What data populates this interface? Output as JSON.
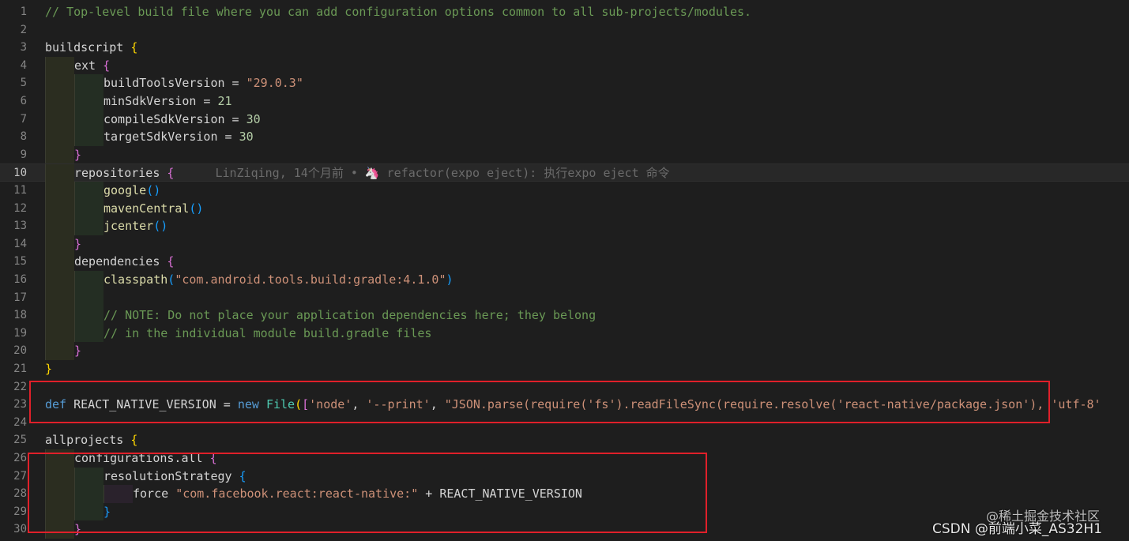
{
  "blame": {
    "text": "LinZiqing, 14个月前 • 🦄 refactor(expo eject): 执行expo eject 命令"
  },
  "watermarks": {
    "primary": "CSDN @前端小菜_AS32H1",
    "secondary": "@稀土掘金技术社区"
  },
  "lines": [
    {
      "n": "1",
      "indent": 0,
      "tokens": [
        [
          "// Top-level build file where you can add configuration options common to all sub-projects/modules.",
          "com"
        ]
      ]
    },
    {
      "n": "2",
      "indent": 0,
      "tokens": []
    },
    {
      "n": "3",
      "indent": 0,
      "tokens": [
        [
          "buildscript ",
          ""
        ],
        [
          "{",
          "br1"
        ]
      ]
    },
    {
      "n": "4",
      "indent": 1,
      "tokens": [
        [
          "ext ",
          ""
        ],
        [
          "{",
          "br2"
        ]
      ]
    },
    {
      "n": "5",
      "indent": 2,
      "tokens": [
        [
          "buildToolsVersion = ",
          ""
        ],
        [
          "\"29.0.3\"",
          "str"
        ]
      ]
    },
    {
      "n": "6",
      "indent": 2,
      "tokens": [
        [
          "minSdkVersion = ",
          ""
        ],
        [
          "21",
          "num"
        ]
      ]
    },
    {
      "n": "7",
      "indent": 2,
      "tokens": [
        [
          "compileSdkVersion = ",
          ""
        ],
        [
          "30",
          "num"
        ]
      ]
    },
    {
      "n": "8",
      "indent": 2,
      "tokens": [
        [
          "targetSdkVersion = ",
          ""
        ],
        [
          "30",
          "num"
        ]
      ]
    },
    {
      "n": "9",
      "indent": 1,
      "tokens": [
        [
          "}",
          "br2"
        ]
      ]
    },
    {
      "n": "10",
      "indent": 1,
      "current": true,
      "blame": true,
      "tokens": [
        [
          "repositories ",
          ""
        ],
        [
          "{",
          "br2"
        ]
      ]
    },
    {
      "n": "11",
      "indent": 2,
      "tokens": [
        [
          "google",
          "fn"
        ],
        [
          "()",
          "br3"
        ]
      ]
    },
    {
      "n": "12",
      "indent": 2,
      "tokens": [
        [
          "mavenCentral",
          "fn"
        ],
        [
          "()",
          "br3"
        ]
      ]
    },
    {
      "n": "13",
      "indent": 2,
      "tokens": [
        [
          "jcenter",
          "fn"
        ],
        [
          "()",
          "br3"
        ]
      ]
    },
    {
      "n": "14",
      "indent": 1,
      "tokens": [
        [
          "}",
          "br2"
        ]
      ]
    },
    {
      "n": "15",
      "indent": 1,
      "tokens": [
        [
          "dependencies ",
          ""
        ],
        [
          "{",
          "br2"
        ]
      ]
    },
    {
      "n": "16",
      "indent": 2,
      "tokens": [
        [
          "classpath",
          "fn"
        ],
        [
          "(",
          "br3"
        ],
        [
          "\"com.android.tools.build:gradle:4.1.0\"",
          "str"
        ],
        [
          ")",
          "br3"
        ]
      ]
    },
    {
      "n": "17",
      "indent": 2,
      "tokens": []
    },
    {
      "n": "18",
      "indent": 2,
      "tokens": [
        [
          "// NOTE: Do not place your application dependencies here; they belong",
          "com"
        ]
      ]
    },
    {
      "n": "19",
      "indent": 2,
      "tokens": [
        [
          "// in the individual module build.gradle files",
          "com"
        ]
      ]
    },
    {
      "n": "20",
      "indent": 1,
      "tokens": [
        [
          "}",
          "br2"
        ]
      ]
    },
    {
      "n": "21",
      "indent": 0,
      "tokens": [
        [
          "}",
          "br1"
        ]
      ]
    },
    {
      "n": "22",
      "indent": 0,
      "tokens": []
    },
    {
      "n": "23",
      "indent": 0,
      "tokens": [
        [
          "def ",
          "kw"
        ],
        [
          "REACT_NATIVE_VERSION = ",
          ""
        ],
        [
          "new ",
          "kw"
        ],
        [
          "File",
          "cls"
        ],
        [
          "(",
          "br1"
        ],
        [
          "[",
          "br2"
        ],
        [
          "'node'",
          "str"
        ],
        [
          ", ",
          ""
        ],
        [
          "'--print'",
          "str"
        ],
        [
          ", ",
          ""
        ],
        [
          "\"JSON.parse(require('fs').readFileSync(require.resolve('react-native/package.json'), 'utf-8'",
          "str"
        ]
      ]
    },
    {
      "n": "24",
      "indent": 0,
      "tokens": []
    },
    {
      "n": "25",
      "indent": 0,
      "tokens": [
        [
          "allprojects ",
          ""
        ],
        [
          "{",
          "br1"
        ]
      ]
    },
    {
      "n": "26",
      "indent": 1,
      "tokens": [
        [
          "configurations.all ",
          ""
        ],
        [
          "{",
          "br2"
        ]
      ]
    },
    {
      "n": "27",
      "indent": 2,
      "tokens": [
        [
          "resolutionStrategy ",
          ""
        ],
        [
          "{",
          "br3"
        ]
      ]
    },
    {
      "n": "28",
      "indent": 3,
      "tokens": [
        [
          "force ",
          ""
        ],
        [
          "\"com.facebook.react:react-native:\"",
          "str"
        ],
        [
          " + REACT_NATIVE_VERSION",
          ""
        ]
      ]
    },
    {
      "n": "29",
      "indent": 2,
      "tokens": [
        [
          "}",
          "br3"
        ]
      ]
    },
    {
      "n": "30",
      "indent": 1,
      "tokens": [
        [
          "}",
          "br2"
        ]
      ]
    }
  ]
}
